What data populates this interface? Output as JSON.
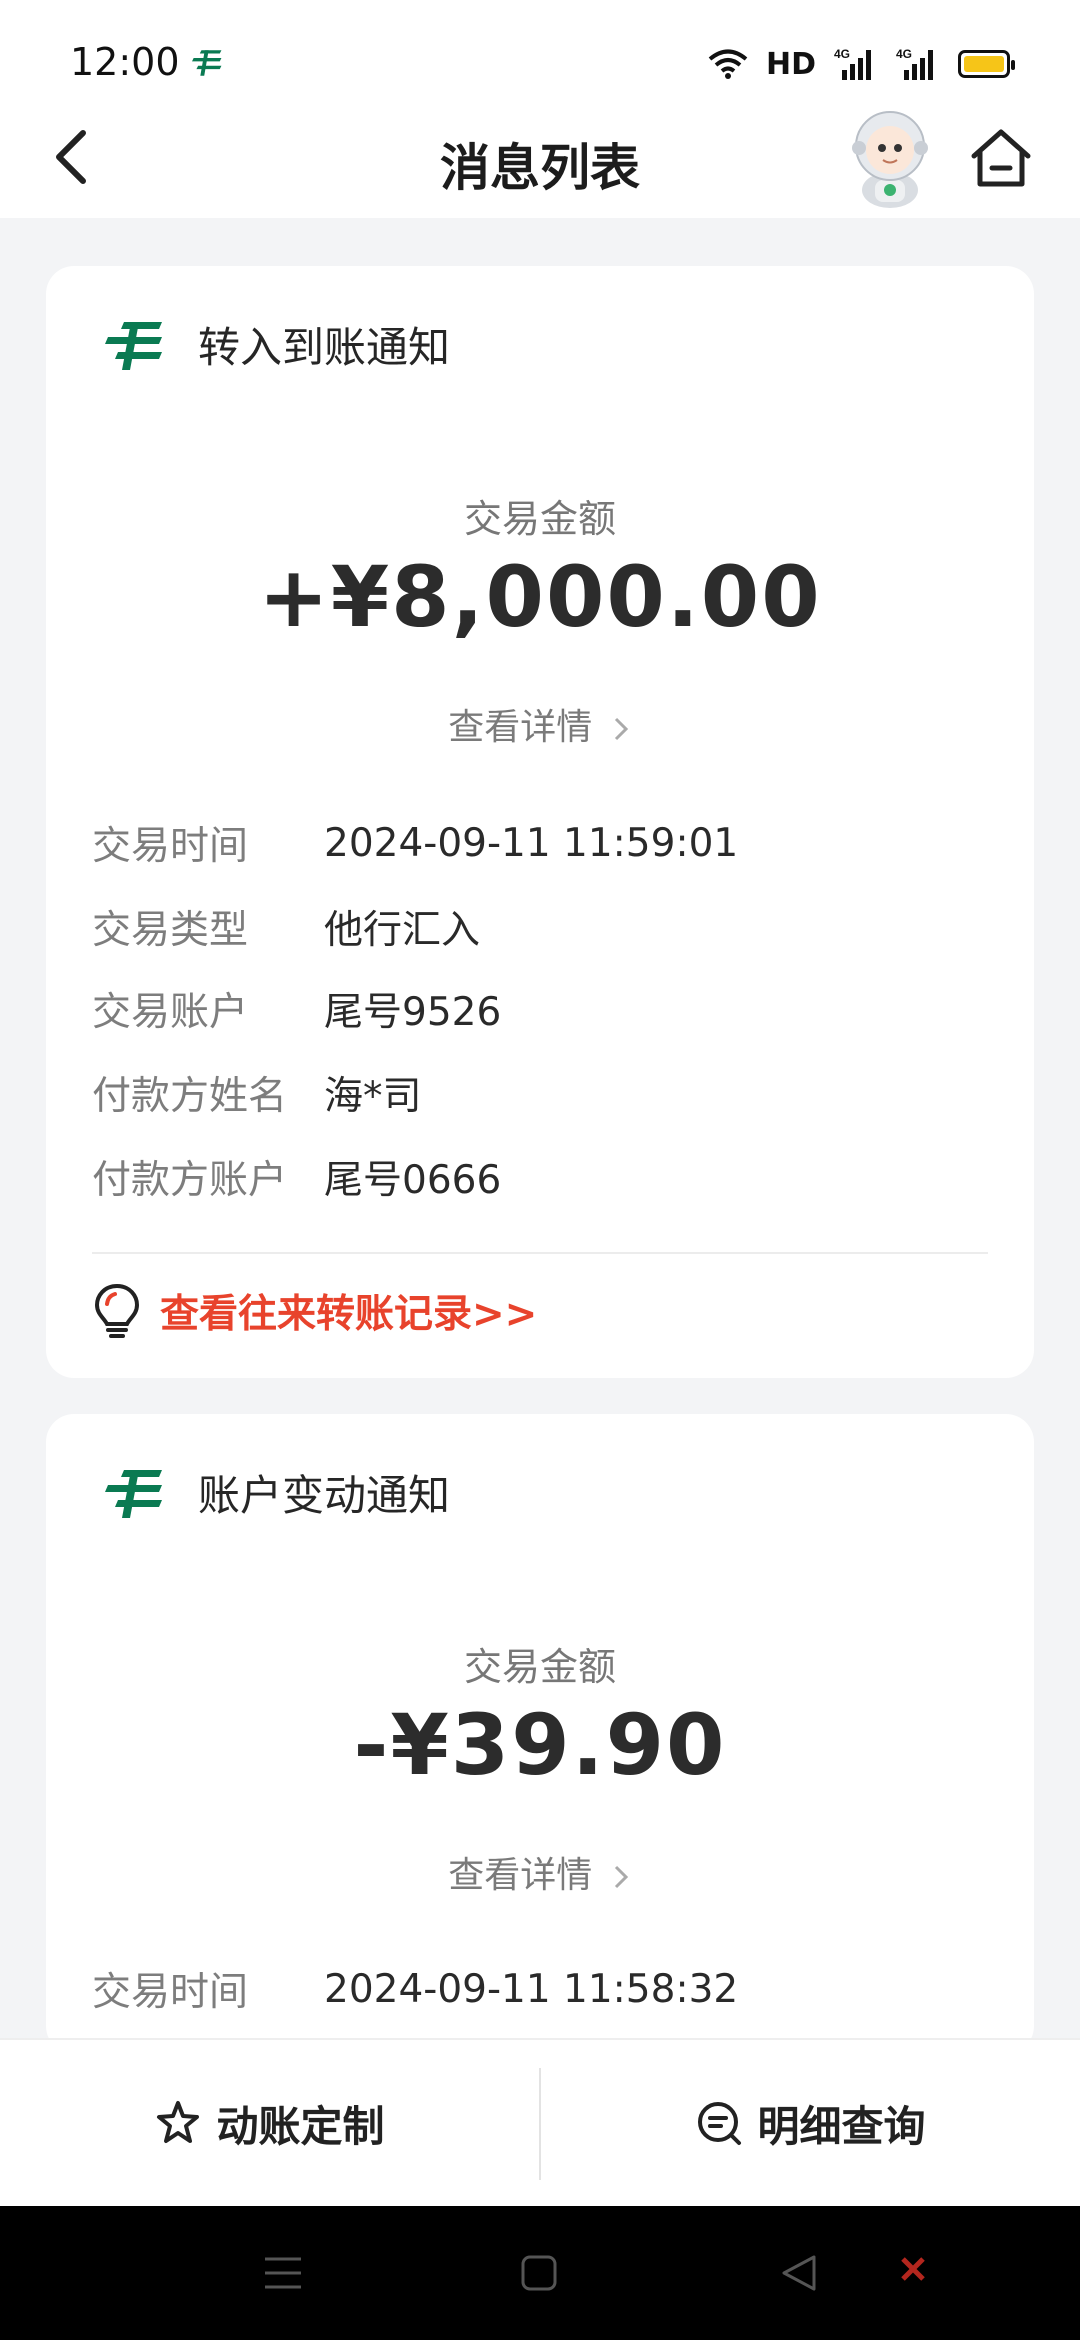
{
  "status_bar": {
    "time": "12:00",
    "network_label": "HD",
    "icons": [
      "postal-bank-logo-icon",
      "wifi-icon",
      "signal-4g-icon",
      "signal-4g-icon",
      "battery-icon"
    ],
    "battery_color": "#f6c518"
  },
  "nav": {
    "title": "消息列表",
    "back_icon": "chevron-left-icon",
    "home_icon": "home-icon",
    "mascot_icon": "astronaut-mascot-icon"
  },
  "brand": {
    "green": "#0a7a52",
    "link_red": "#e8432c"
  },
  "cards": [
    {
      "title": "转入到账通知",
      "amount_label": "交易金额",
      "amount": "+¥8,000.00",
      "detail_link": "查看详情",
      "rows": [
        {
          "label": "交易时间",
          "value": "2024-09-11 11:59:01"
        },
        {
          "label": "交易类型",
          "value": "他行汇入"
        },
        {
          "label": "交易账户",
          "value": "尾号9526"
        },
        {
          "label": "付款方姓名",
          "value": "海*司"
        },
        {
          "label": "付款方账户",
          "value": "尾号0666"
        }
      ],
      "history_link": "查看往来转账记录>>"
    },
    {
      "title": "账户变动通知",
      "amount_label": "交易金额",
      "amount": "-¥39.90",
      "detail_link": "查看详情",
      "rows": [
        {
          "label": "交易时间",
          "value": "2024-09-11 11:58:32"
        }
      ]
    }
  ],
  "action_bar": {
    "left_label": "动账定制",
    "right_label": "明细查询"
  }
}
